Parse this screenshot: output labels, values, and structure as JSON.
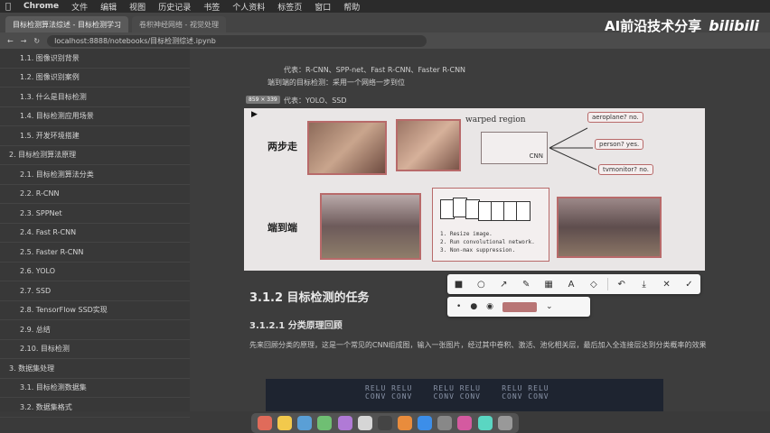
{
  "menubar": {
    "apple": "",
    "app": "Chrome",
    "items": [
      "文件",
      "编辑",
      "视图",
      "历史记录",
      "书签",
      "个人资料",
      "标签页",
      "窗口",
      "帮助"
    ]
  },
  "tabs": [
    {
      "label": "目标检测算法综述 - 目标检测学习",
      "active": true
    },
    {
      "label": "卷积神经网络 - 视觉处理",
      "active": false
    }
  ],
  "address": {
    "url": "localhost:8888/notebooks/目标检测综述.ipynb"
  },
  "brand": {
    "text": "AI前沿技术分享",
    "logo": "bilibili"
  },
  "sidebar": {
    "items": [
      {
        "label": "1.1. 图像识别背景",
        "level": 2
      },
      {
        "label": "1.2. 图像识别案例",
        "level": 2
      },
      {
        "label": "1.3. 什么是目标检测",
        "level": 2
      },
      {
        "label": "1.4. 目标检测应用场景",
        "level": 2
      },
      {
        "label": "1.5. 开发环境搭建",
        "level": 2
      },
      {
        "label": "2. 目标检测算法原理",
        "level": 1
      },
      {
        "label": "2.1. 目标检测算法分类",
        "level": 2
      },
      {
        "label": "2.2. R-CNN",
        "level": 2
      },
      {
        "label": "2.3. SPPNet",
        "level": 2
      },
      {
        "label": "2.4. Fast R-CNN",
        "level": 2
      },
      {
        "label": "2.5. Faster R-CNN",
        "level": 2
      },
      {
        "label": "2.6. YOLO",
        "level": 2
      },
      {
        "label": "2.7. SSD",
        "level": 2
      },
      {
        "label": "2.8. TensorFlow SSD实现",
        "level": 2
      },
      {
        "label": "2.9. 总结",
        "level": 2
      },
      {
        "label": "2.10. 目标检测",
        "level": 2
      },
      {
        "label": "3. 数据集处理",
        "level": 1
      },
      {
        "label": "3.1. 目标检测数据集",
        "level": 2
      },
      {
        "label": "3.2. 数据集格式",
        "level": 2
      }
    ]
  },
  "main": {
    "bullet1": "代表：R-CNN、SPP-net、Fast R-CNN、Faster R-CNN",
    "bullet2": "端到端的目标检测：采用一个网络一步到位",
    "bullet3": "代表：YOLO、SSD",
    "coord_badge": "859 × 339",
    "figure": {
      "label_two_step": "两步走",
      "label_end_to_end": "端到端",
      "warped": "warped region",
      "cls_aeroplane": "aeroplane? no.",
      "cls_person": "person? yes.",
      "cls_tvmonitor": "tvmonitor? no.",
      "cnn": "CNN",
      "steps": [
        "1. Resize image.",
        "2. Run convolutional network.",
        "3. Non-max suppression."
      ]
    },
    "h2": "3.1.2 目标检测的任务",
    "h3": "3.1.2.1 分类原理回顾",
    "para": "先来回顾分类的原理，这是一个常见的CNN组成图，输入一张图片，经过其中卷积、激活、池化相关层，最后加入全连接层达到分类概率的效果",
    "code": "RELU RELU    RELU RELU    RELU RELU\nCONV CONV    CONV CONV    CONV CONV"
  },
  "annotation_toolbar": {
    "tools": [
      "rectangle-tool",
      "ellipse-tool",
      "arrow-tool",
      "pen-tool",
      "mosaic-tool",
      "text-tool",
      "eraser-tool",
      "undo",
      "download",
      "cancel",
      "confirm"
    ],
    "glyphs": [
      "■",
      "○",
      "↗",
      "✎",
      "▦",
      "A",
      "◇",
      "↶",
      "⤓",
      "✕",
      "✓"
    ],
    "size_glyphs": [
      "•",
      "●",
      "◉"
    ],
    "color": "#b87575"
  },
  "dock": {
    "colors": [
      "#e06b5a",
      "#f2c94c",
      "#5a9fd6",
      "#6fbf73",
      "#b07ad6",
      "#d6d6d6",
      "#444",
      "#e98c3c",
      "#3c8ee9",
      "#888",
      "#d45aa0",
      "#5ad6c2",
      "#999"
    ]
  }
}
